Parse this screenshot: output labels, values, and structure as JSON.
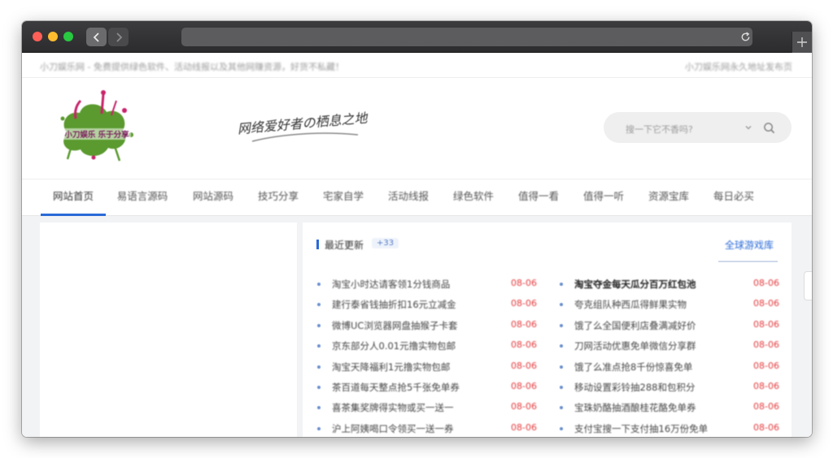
{
  "browser": {
    "url": "",
    "colors": {
      "titlebar": "#2c2c2e",
      "close": "#fe5f57",
      "minimize": "#febc2e",
      "maximize": "#28c840"
    }
  },
  "site": {
    "topbar_left": "小刀娱乐网 - 免费提供绿色软件、活动线报以及其他网赚资源，好货不私藏！",
    "topbar_right": "小刀娱乐网永久地址发布页",
    "logo_text": "小刀娱乐 乐于分享",
    "slogan": "网络爱好者の栖息之地",
    "search_placeholder": "搜一下它不香吗?"
  },
  "nav": {
    "items": [
      "网站首页",
      "易语言源码",
      "网站源码",
      "技巧分享",
      "宅家自学",
      "活动线报",
      "绿色软件",
      "值得一看",
      "值得一听",
      "资源宝库",
      "每日必买"
    ],
    "active_index": 0,
    "accent": "#2a6ad7"
  },
  "latest": {
    "title": "最近更新",
    "badge": "+33",
    "more": "全球游戏库",
    "left_column": [
      {
        "title": "淘宝小时达请客领1分钱商品",
        "date": "08-06"
      },
      {
        "title": "建行泰省钱抽折扣16元立减金",
        "date": "08-06"
      },
      {
        "title": "微博UC浏览器网盘抽猴子卡套",
        "date": "08-06"
      },
      {
        "title": "京东部分人0.01元撸实物包邮",
        "date": "08-06"
      },
      {
        "title": "淘宝天降福利1元撸实物包邮",
        "date": "08-06"
      },
      {
        "title": "茶百道每天整点抢5千张免单券",
        "date": "08-06"
      },
      {
        "title": "喜茶集奖牌得实物或买一送一",
        "date": "08-06"
      },
      {
        "title": "沪上阿姨喝口令领买一送一券",
        "date": "08-06"
      }
    ],
    "right_column": [
      {
        "title": "淘宝夺金每天瓜分百万红包池",
        "date": "08-06",
        "bold": true
      },
      {
        "title": "夸克组队种西瓜得鲜果实物",
        "date": "08-06"
      },
      {
        "title": "饿了么全国便利店叠满减好价",
        "date": "08-06"
      },
      {
        "title": "刀网活动优惠免单微信分享群",
        "date": "08-06"
      },
      {
        "title": "饿了么准点抢8千份惊喜免单",
        "date": "08-06"
      },
      {
        "title": "移动设置彩铃抽288和包积分",
        "date": "08-06"
      },
      {
        "title": "宝珠奶酪抽酒酿桂花酪免单券",
        "date": "08-06"
      },
      {
        "title": "支付宝搜一下支付抽16万份免单",
        "date": "08-06"
      }
    ],
    "date_color": "#e4393c"
  }
}
